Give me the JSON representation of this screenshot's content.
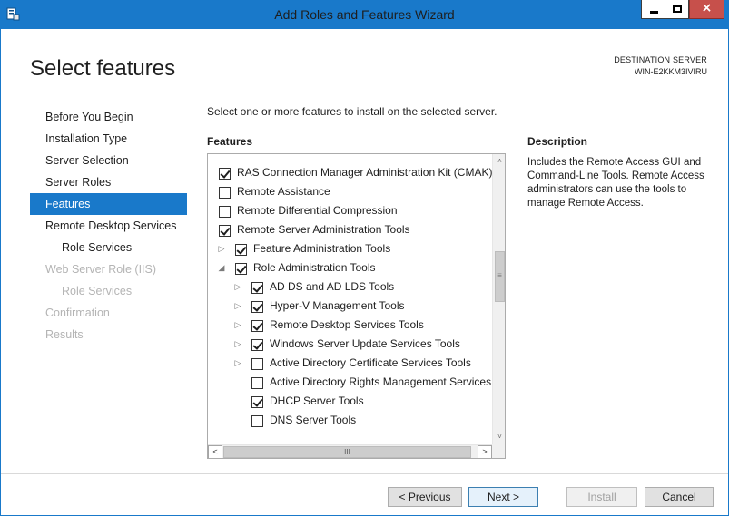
{
  "window": {
    "title": "Add Roles and Features Wizard",
    "accent_color": "#1979ca",
    "close_glyph": "×"
  },
  "header": {
    "heading": "Select features",
    "destination_label": "DESTINATION SERVER",
    "destination_value": "WIN-E2KKM3IVIRU"
  },
  "nav": {
    "items": [
      {
        "label": "Before You Begin",
        "state": "normal"
      },
      {
        "label": "Installation Type",
        "state": "normal"
      },
      {
        "label": "Server Selection",
        "state": "normal"
      },
      {
        "label": "Server Roles",
        "state": "normal"
      },
      {
        "label": "Features",
        "state": "active"
      },
      {
        "label": "Remote Desktop Services",
        "state": "normal"
      },
      {
        "label": "Role Services",
        "state": "normal",
        "indent": true
      },
      {
        "label": "Web Server Role (IIS)",
        "state": "disabled"
      },
      {
        "label": "Role Services",
        "state": "disabled",
        "indent": true
      },
      {
        "label": "Confirmation",
        "state": "disabled"
      },
      {
        "label": "Results",
        "state": "disabled"
      }
    ]
  },
  "main": {
    "instruction": "Select one or more features to install on the selected server.",
    "features_heading": "Features",
    "description_heading": "Description",
    "description_text": "Includes the Remote Access GUI and Command-Line Tools. Remote Access administrators can use the tools to manage Remote Access."
  },
  "features": [
    {
      "label": "RAS Connection Manager Administration Kit (CMAK)",
      "checked": true,
      "level": 0,
      "expander": "none"
    },
    {
      "label": "Remote Assistance",
      "checked": false,
      "level": 0,
      "expander": "none"
    },
    {
      "label": "Remote Differential Compression",
      "checked": false,
      "level": 0,
      "expander": "none"
    },
    {
      "label": "Remote Server Administration Tools",
      "checked": true,
      "level": 0,
      "expander": "none"
    },
    {
      "label": "Feature Administration Tools",
      "checked": true,
      "level": 1,
      "expander": "collapsed"
    },
    {
      "label": "Role Administration Tools",
      "checked": true,
      "level": 1,
      "expander": "expanded"
    },
    {
      "label": "AD DS and AD LDS Tools",
      "checked": true,
      "level": 2,
      "expander": "collapsed"
    },
    {
      "label": "Hyper-V Management Tools",
      "checked": true,
      "level": 2,
      "expander": "collapsed"
    },
    {
      "label": "Remote Desktop Services Tools",
      "checked": true,
      "level": 2,
      "expander": "collapsed"
    },
    {
      "label": "Windows Server Update Services Tools",
      "checked": true,
      "level": 2,
      "expander": "collapsed"
    },
    {
      "label": "Active Directory Certificate Services Tools",
      "checked": false,
      "level": 2,
      "expander": "collapsed"
    },
    {
      "label": "Active Directory Rights Management Services",
      "checked": false,
      "level": 2,
      "expander": "none"
    },
    {
      "label": "DHCP Server Tools",
      "checked": true,
      "level": 2,
      "expander": "none"
    },
    {
      "label": "DNS Server Tools",
      "checked": false,
      "level": 2,
      "expander": "none"
    }
  ],
  "scrollbars": {
    "up": "˄",
    "down": "˅",
    "left": "<",
    "right": ">",
    "vgrip": "≡",
    "hgrip": "III"
  },
  "footer": {
    "previous": "< Previous",
    "next": "Next >",
    "install": "Install",
    "cancel": "Cancel"
  }
}
